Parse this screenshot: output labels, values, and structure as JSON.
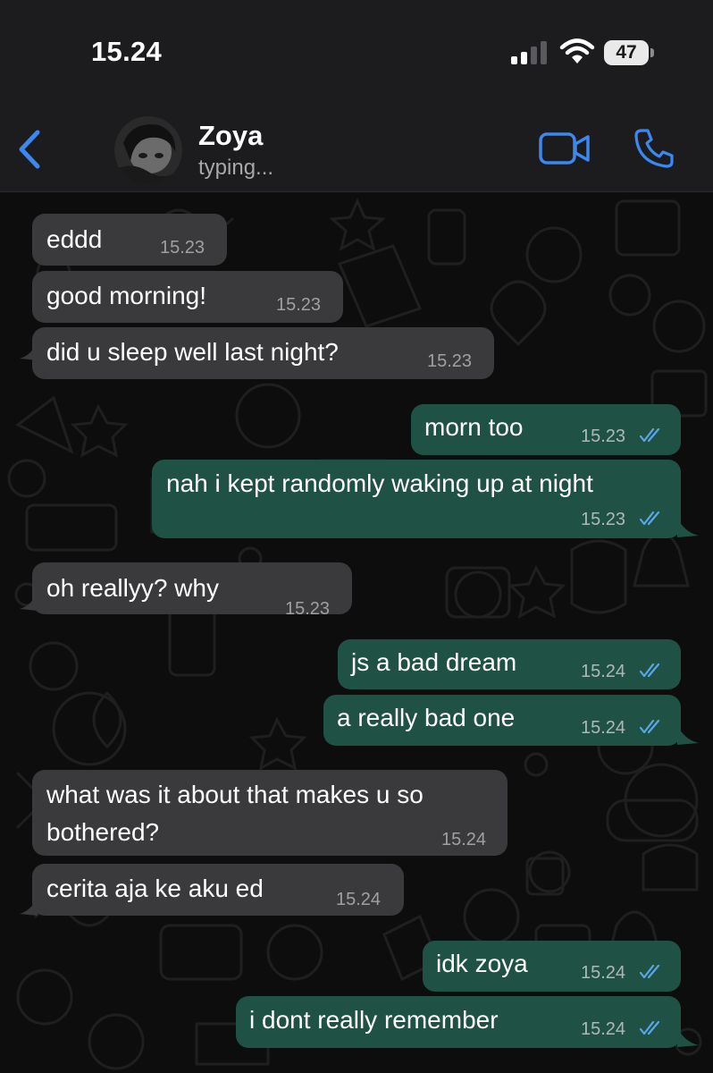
{
  "status_bar": {
    "time": "15.24",
    "battery": "47"
  },
  "header": {
    "contact_name": "Zoya",
    "status": "typing..."
  },
  "icons": {
    "back": "chevron-left-icon",
    "video": "video-camera-icon",
    "call": "phone-icon",
    "read": "double-check-icon"
  },
  "colors": {
    "accent": "#3a88f0",
    "incoming_bubble": "#3a3a3c",
    "outgoing_bubble": "#1f5144",
    "read_ticks": "#5aa7e8"
  },
  "messages": [
    {
      "direction": "in",
      "text": "eddd",
      "time": "15.23"
    },
    {
      "direction": "in",
      "text": "good morning!",
      "time": "15.23"
    },
    {
      "direction": "in",
      "text": "did u sleep well last night?",
      "time": "15.23"
    },
    {
      "direction": "out",
      "text": "morn too",
      "time": "15.23",
      "read": true
    },
    {
      "direction": "out",
      "text": "nah i kept randomly waking up at night",
      "time": "15.23",
      "read": true
    },
    {
      "direction": "in",
      "text": "oh reallyy? why",
      "time": "15.23"
    },
    {
      "direction": "out",
      "text": "js a bad dream",
      "time": "15.24",
      "read": true
    },
    {
      "direction": "out",
      "text": "a really bad one",
      "time": "15.24",
      "read": true
    },
    {
      "direction": "in",
      "text_lines": [
        "what was it about that makes u so",
        "bothered?"
      ],
      "time": "15.24"
    },
    {
      "direction": "in",
      "text": "cerita aja ke aku ed",
      "time": "15.24"
    },
    {
      "direction": "out",
      "text": "idk zoya",
      "time": "15.24",
      "read": true
    },
    {
      "direction": "out",
      "text": "i dont really remember",
      "time": "15.24",
      "read": true
    }
  ]
}
